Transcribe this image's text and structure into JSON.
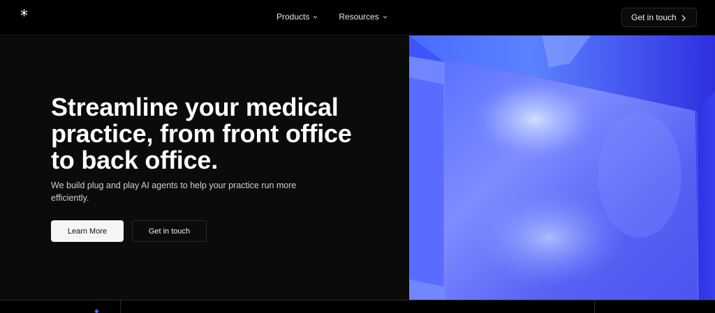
{
  "header": {
    "logo_glyph": "*",
    "nav": [
      {
        "label": "Products",
        "icon": "chevron-down-icon"
      },
      {
        "label": "Resources",
        "icon": "chevron-down-icon"
      }
    ],
    "cta_label": "Get in touch",
    "cta_icon": "chevron-right-icon"
  },
  "hero": {
    "title": "Streamline your medical practice, from front office to back office.",
    "subtitle": "We build plug and play AI agents to help your practice run more efficiently.",
    "primary_button": "Learn More",
    "secondary_button": "Get in touch"
  },
  "colors": {
    "background": "#000000",
    "panel": "#0b0b0c",
    "accent_blue": "#3f43ef",
    "button_light": "#f5f5f5"
  }
}
